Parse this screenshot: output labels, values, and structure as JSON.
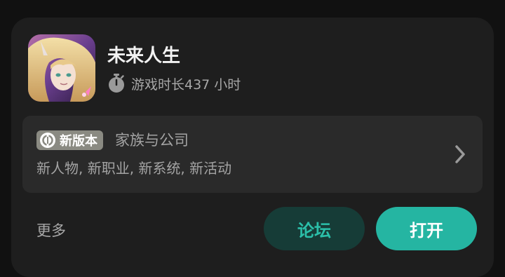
{
  "app": {
    "title": "未来人生",
    "playtime": "游戏时长437 小时",
    "icon": "game-app-icon"
  },
  "update": {
    "badge": "新版本",
    "title": "家族与公司",
    "description": "新人物, 新职业, 新系统, 新活动"
  },
  "actions": {
    "more": "更多",
    "forum": "论坛",
    "open": "打开"
  },
  "colors": {
    "background": "#111111",
    "card": "#1e1e1e",
    "panel": "#2a2a2a",
    "accent": "#25b5a2",
    "accent_dark": "#163c37"
  }
}
